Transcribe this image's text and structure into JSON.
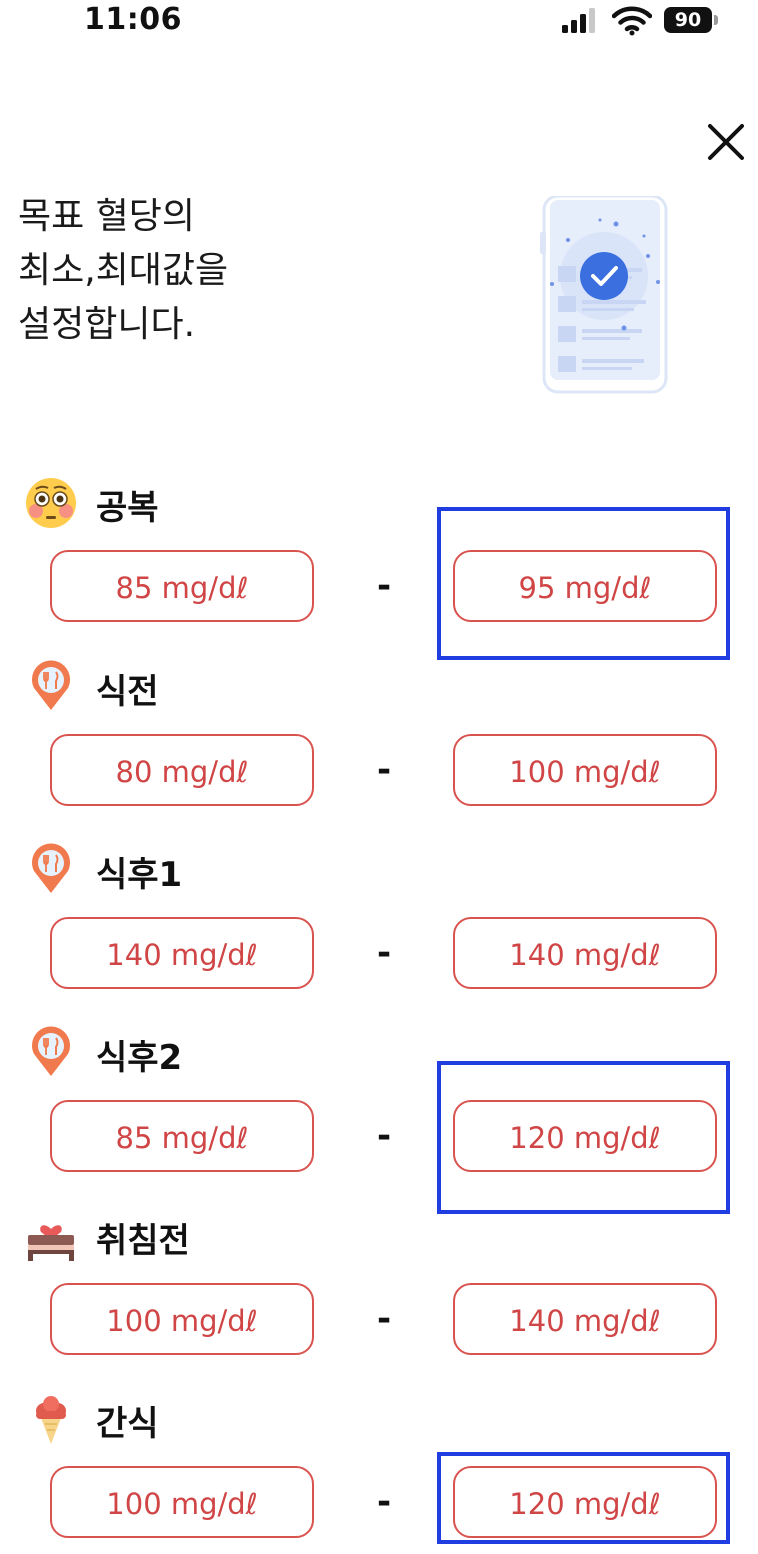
{
  "status_bar": {
    "time": "11:06",
    "battery": "90"
  },
  "header": {
    "title_lines": [
      "목표 혈당의",
      "최소,최대값을",
      "설정합니다."
    ]
  },
  "sections": [
    {
      "label": "공복",
      "icon": "flushed-face-icon",
      "min": "85 mg/dℓ",
      "max": "95 mg/dℓ"
    },
    {
      "label": "식전",
      "icon": "restaurant-pin-icon",
      "min": "80 mg/dℓ",
      "max": "100 mg/dℓ"
    },
    {
      "label": "식후1",
      "icon": "restaurant-pin-icon",
      "min": "140 mg/dℓ",
      "max": "140 mg/dℓ"
    },
    {
      "label": "식후2",
      "icon": "restaurant-pin-icon",
      "min": "85 mg/dℓ",
      "max": "120 mg/dℓ"
    },
    {
      "label": "취침전",
      "icon": "bed-heart-icon",
      "min": "100 mg/dℓ",
      "max": "140 mg/dℓ"
    },
    {
      "label": "간식",
      "icon": "ice-cream-icon",
      "min": "100 mg/dℓ",
      "max": "120 mg/dℓ"
    }
  ],
  "range_separator": "-",
  "colors": {
    "accent_red": "#d9534f",
    "highlight_blue": "#1f3de0",
    "check_blue": "#3b6fe0"
  }
}
